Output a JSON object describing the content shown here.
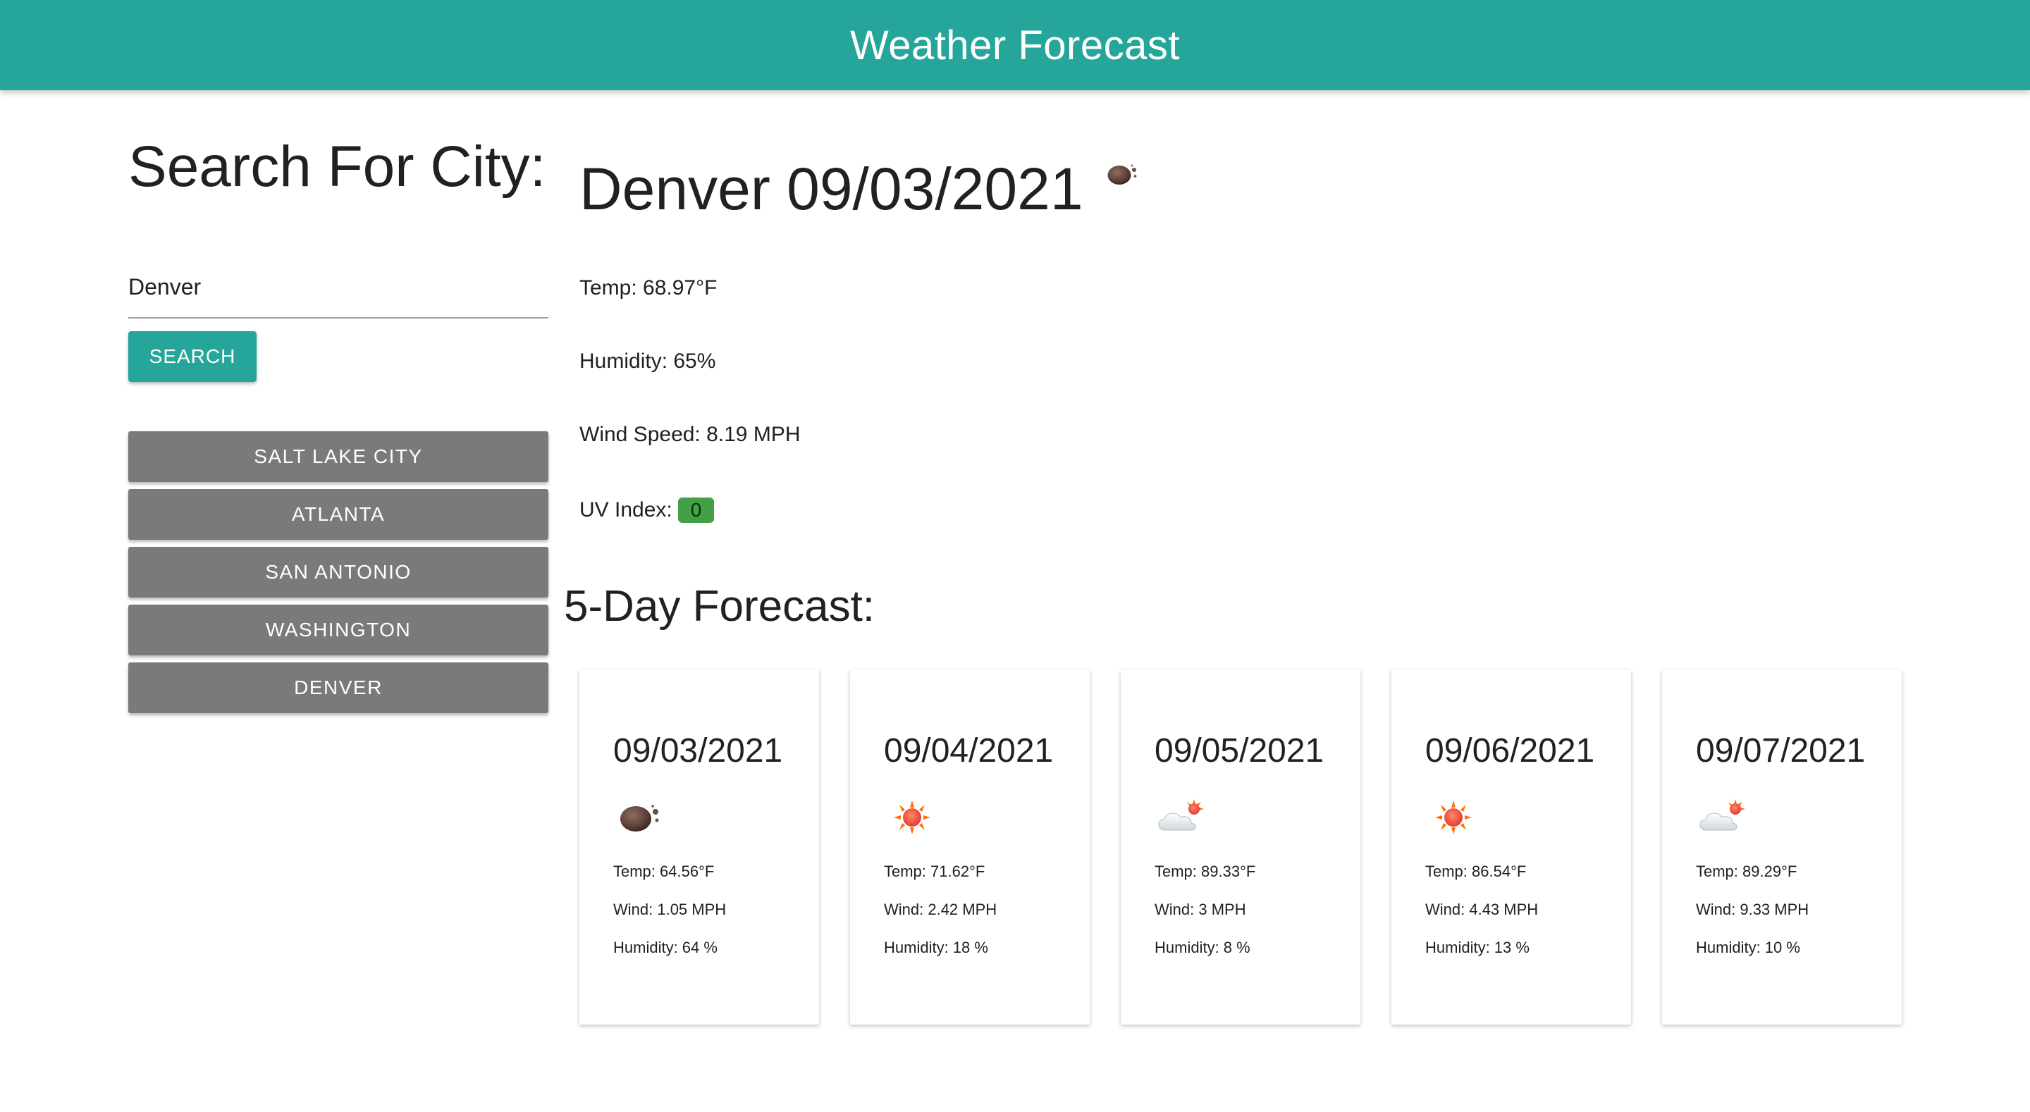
{
  "header": {
    "title": "Weather Forecast"
  },
  "search": {
    "heading": "Search For City:",
    "input_value": "Denver",
    "button_label": "SEARCH"
  },
  "history": [
    "SALT LAKE CITY",
    "ATLANTA",
    "SAN ANTONIO",
    "WASHINGTON",
    "DENVER"
  ],
  "current": {
    "title": "Denver 09/03/2021",
    "icon": "moon-icon",
    "temp": "Temp: 68.97°F",
    "humidity": "Humidity: 65%",
    "wind": "Wind Speed: 8.19 MPH",
    "uv_label": "UV Index:",
    "uv_value": "0",
    "uv_color": "#43a047"
  },
  "forecast": {
    "heading": "5-Day Forecast:",
    "days": [
      {
        "date": "09/03/2021",
        "icon": "moon-icon",
        "temp": "Temp: 64.56°F",
        "wind": "Wind: 1.05 MPH",
        "humidity": "Humidity: 64 %"
      },
      {
        "date": "09/04/2021",
        "icon": "sun-icon",
        "temp": "Temp: 71.62°F",
        "wind": "Wind: 2.42 MPH",
        "humidity": "Humidity: 18 %"
      },
      {
        "date": "09/05/2021",
        "icon": "cloud-sun-icon",
        "temp": "Temp: 89.33°F",
        "wind": "Wind: 3 MPH",
        "humidity": "Humidity: 8 %"
      },
      {
        "date": "09/06/2021",
        "icon": "sun-icon",
        "temp": "Temp: 86.54°F",
        "wind": "Wind: 4.43 MPH",
        "humidity": "Humidity: 13 %"
      },
      {
        "date": "09/07/2021",
        "icon": "cloud-sun-icon",
        "temp": "Temp: 89.29°F",
        "wind": "Wind: 9.33 MPH",
        "humidity": "Humidity: 10 %"
      }
    ]
  },
  "colors": {
    "accent": "#26a69a",
    "history_button": "#7a7a7a"
  }
}
